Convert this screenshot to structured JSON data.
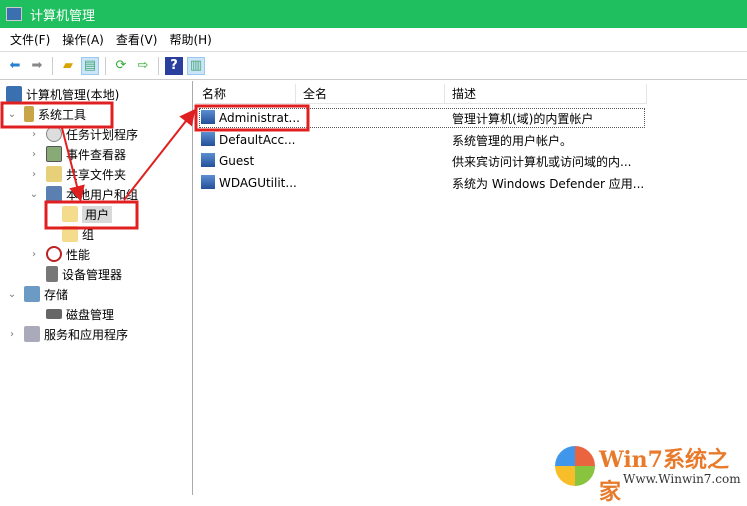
{
  "window": {
    "title": "计算机管理"
  },
  "menu": [
    "文件(F)",
    "操作(A)",
    "查看(V)",
    "帮助(H)"
  ],
  "tree": {
    "root": "计算机管理(本地)",
    "system_tools": "系统工具",
    "task_scheduler": "任务计划程序",
    "event_viewer": "事件查看器",
    "shared_folders": "共享文件夹",
    "local_users": "本地用户和组",
    "users": "用户",
    "groups": "组",
    "performance": "性能",
    "device_manager": "设备管理器",
    "storage": "存储",
    "disk_management": "磁盘管理",
    "services": "服务和应用程序"
  },
  "list": {
    "columns": [
      "名称",
      "全名",
      "描述"
    ],
    "rows": [
      {
        "name": "Administrat...",
        "full": "",
        "desc": "管理计算机(域)的内置帐户"
      },
      {
        "name": "DefaultAcc...",
        "full": "",
        "desc": "系统管理的用户帐户。"
      },
      {
        "name": "Guest",
        "full": "",
        "desc": "供来宾访问计算机或访问域的内..."
      },
      {
        "name": "WDAGUtilit...",
        "full": "",
        "desc": "系统为 Windows Defender 应用..."
      }
    ]
  },
  "watermark": {
    "brand": "Win7系统之家",
    "url": "Www.Winwin7.com"
  },
  "colors": {
    "titlebar": "#1fbf5f",
    "highlight": "#e02020"
  }
}
